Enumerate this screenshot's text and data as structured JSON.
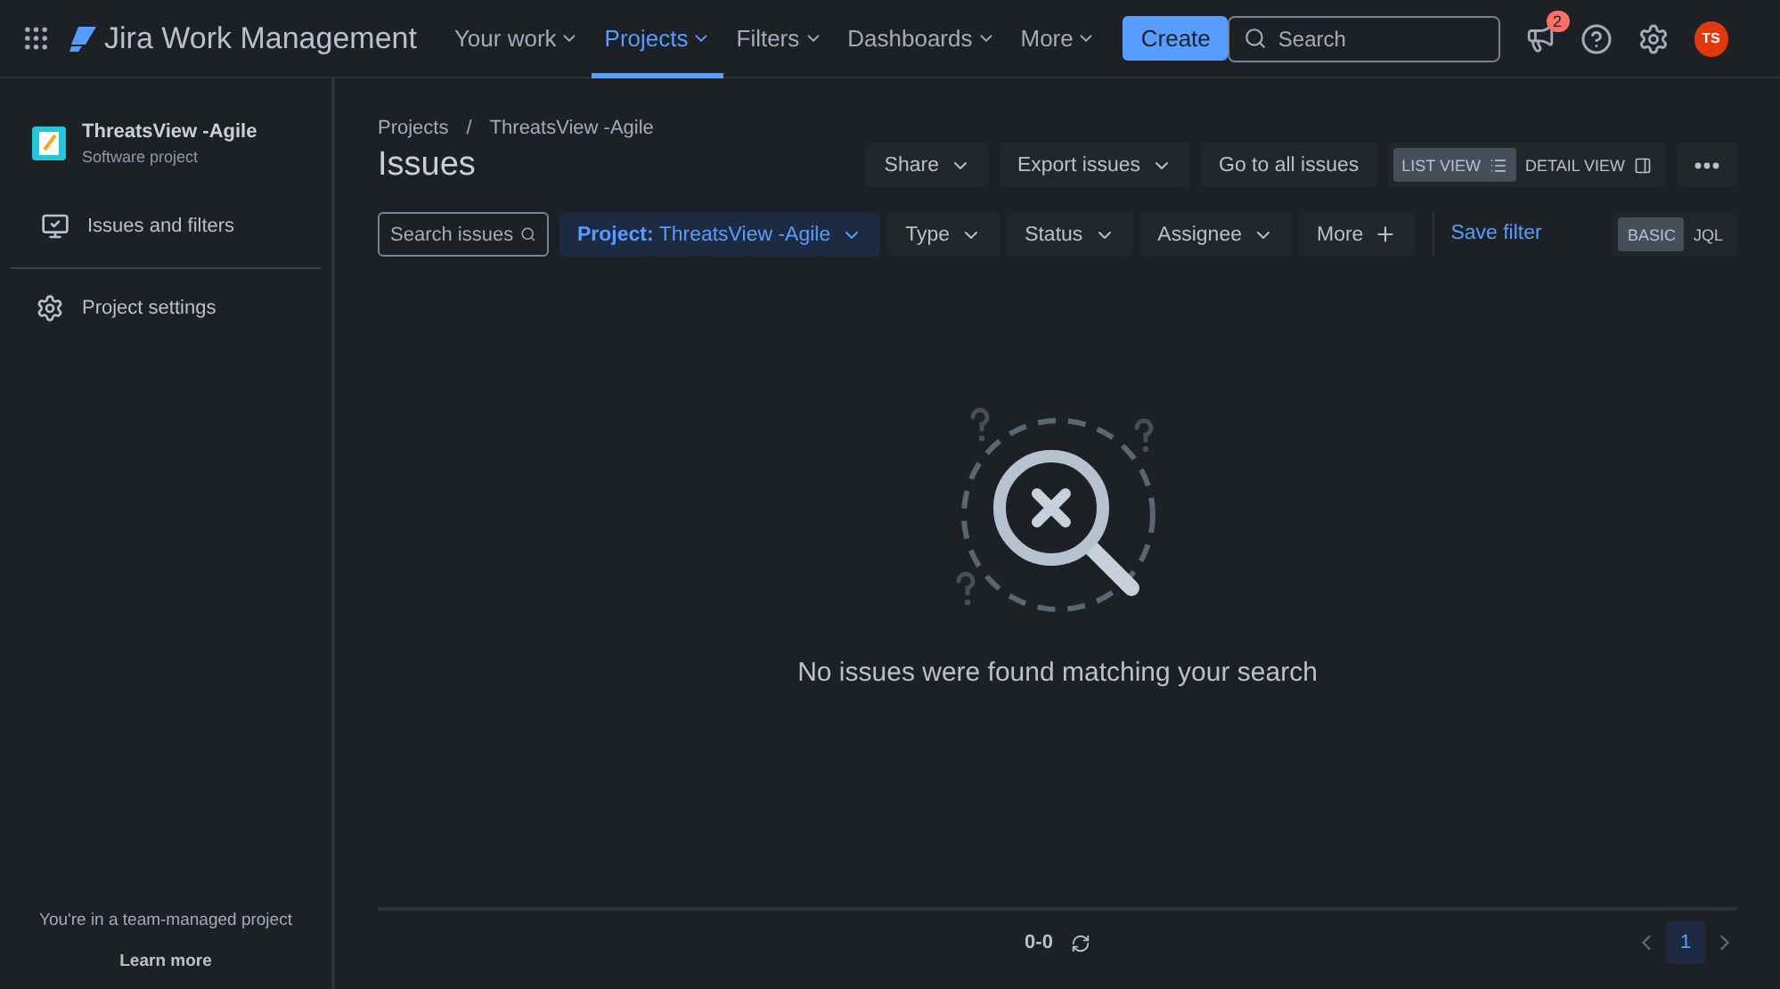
{
  "topnav": {
    "product": "Jira Work Management",
    "items": [
      {
        "label": "Your work",
        "selected": false
      },
      {
        "label": "Projects",
        "selected": true
      },
      {
        "label": "Filters",
        "selected": false
      },
      {
        "label": "Dashboards",
        "selected": false
      },
      {
        "label": "More",
        "selected": false
      }
    ],
    "create": "Create",
    "search": {
      "placeholder": "Search"
    },
    "notifications": "2",
    "avatar": "TS"
  },
  "sidebar": {
    "project": {
      "name": "ThreatsView -Agile",
      "type": "Software project"
    },
    "items": [
      {
        "label": "Issues and filters",
        "kind": "issues"
      },
      {
        "label": "Project settings",
        "kind": "settings"
      }
    ],
    "footer": {
      "text": "You're in a team-managed project",
      "link": "Learn more"
    }
  },
  "breadcrumbs": {
    "items": [
      "Projects",
      "ThreatsView -Agile"
    ],
    "separator": "/"
  },
  "title": "Issues",
  "actions": [
    {
      "label": "Share",
      "dropdown": true
    },
    {
      "label": "Export issues",
      "dropdown": true
    },
    {
      "label": "Go to all issues",
      "dropdown": false
    }
  ],
  "views": [
    {
      "label": "LIST VIEW",
      "selected": true,
      "kind": "list"
    },
    {
      "label": "DETAIL VIEW",
      "selected": false,
      "kind": "detail"
    }
  ],
  "filters": [
    {
      "kind": "search",
      "placeholder": "Search issues"
    },
    {
      "kind": "dropdown",
      "label": "**Project:** ThreatsView -Agile",
      "selected": true
    },
    {
      "kind": "dropdown",
      "label": "Type",
      "selected": false
    },
    {
      "kind": "dropdown",
      "label": "Status",
      "selected": false
    },
    {
      "kind": "dropdown",
      "label": "Assignee",
      "selected": false
    },
    {
      "kind": "more",
      "label": "More"
    },
    {
      "kind": "link",
      "label": "Save filter"
    }
  ],
  "modes": [
    {
      "label": "BASIC",
      "selected": true
    },
    {
      "label": "JQL",
      "selected": false
    }
  ],
  "empty": {
    "message": "No issues were found matching your search"
  },
  "pagination": {
    "range": "0-0",
    "pages": [
      {
        "label": "1",
        "selected": true
      }
    ]
  }
}
